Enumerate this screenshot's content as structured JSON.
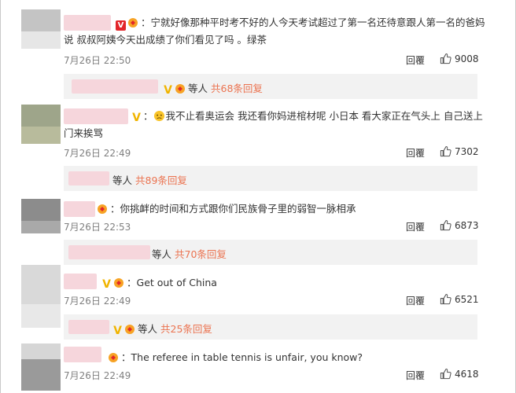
{
  "comments": [
    {
      "text_line1": "宁就好像那种平时考不好的人今天考试超过了第一名还待意跟人第一名的爸妈",
      "text_line2": "说 叔叔阿姨今天出成绩了你们看见了吗 。绿茶",
      "date": "7月26日 22:50",
      "reply_label": "回覆",
      "likes": "9008",
      "sub_replies": {
        "prefix": "等人",
        "count_text": "共68条回复"
      }
    },
    {
      "text_line1": "我不止看奥运会 我还看你妈进棺材呢 小日本 看大家正在气头上 自己送上",
      "text_line2": "门来挨骂",
      "date": "7月26日 22:49",
      "reply_label": "回覆",
      "likes": "7302",
      "sub_replies": {
        "prefix": "等人",
        "count_text": "共89条回复"
      }
    },
    {
      "text_line1": "你挑衅的时间和方式跟你们民族骨子里的弱智一脉相承",
      "date": "7月26日 22:53",
      "reply_label": "回覆",
      "likes": "6873",
      "sub_replies": {
        "prefix": "等人",
        "count_text": "共70条回复"
      }
    },
    {
      "text_line1": "Get out of China",
      "date": "7月26日 22:49",
      "reply_label": "回覆",
      "likes": "6521",
      "sub_replies": {
        "prefix": "等人",
        "count_text": "共25条回复"
      }
    },
    {
      "text_line1": "The referee in table tennis is unfair, you know?",
      "date": "7月26日 22:49",
      "reply_label": "回覆",
      "likes": "4618"
    }
  ],
  "icons": {
    "like": "thumbs-up-icon",
    "verified": "verified-v-icon",
    "fan_badge": "fan-badge-icon",
    "emoji": "confused-emoji-icon"
  },
  "colors": {
    "reply_count": "#eb7350",
    "verified_red": "#e2262a",
    "verified_gold": "#f0b400",
    "name_blur": "#f6d6dc",
    "subbar_bg": "#f2f2f2"
  }
}
